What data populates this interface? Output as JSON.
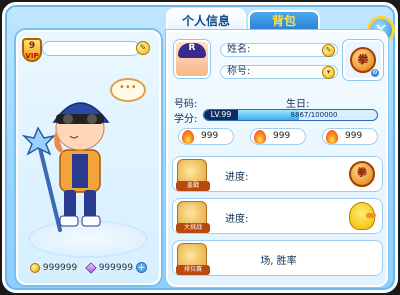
{
  "tabs": {
    "profile": "个人信息",
    "bag": "背包"
  },
  "close_glyph": "✕",
  "left": {
    "vip_level": "9",
    "vip_label": "VIP",
    "gold": "999999",
    "gems": "999999",
    "plus_glyph": "+"
  },
  "profile": {
    "avatar_letter": "R",
    "name_label": "姓名:",
    "title_label": "称号:",
    "seal_text": "拳",
    "id_label": "号码:",
    "birthday_label": "生日:",
    "level_label": "学分:",
    "level_value": "LV.99",
    "exp_text": "8867/100000",
    "exp_fraction": 0.55,
    "stats": [
      "999",
      "999",
      "999"
    ]
  },
  "cards": [
    {
      "icon_label": "盖戳",
      "text": "进度:",
      "badge": "拳"
    },
    {
      "icon_label": "大挑战",
      "text": "进度:"
    },
    {
      "icon_label": "排位赛",
      "text": "场, 胜率"
    }
  ],
  "colors": {
    "accent": "#2a82d6",
    "frame": "#9ad4ff",
    "gold": "#f0b400",
    "exp_fill": "#3ab0ec"
  }
}
